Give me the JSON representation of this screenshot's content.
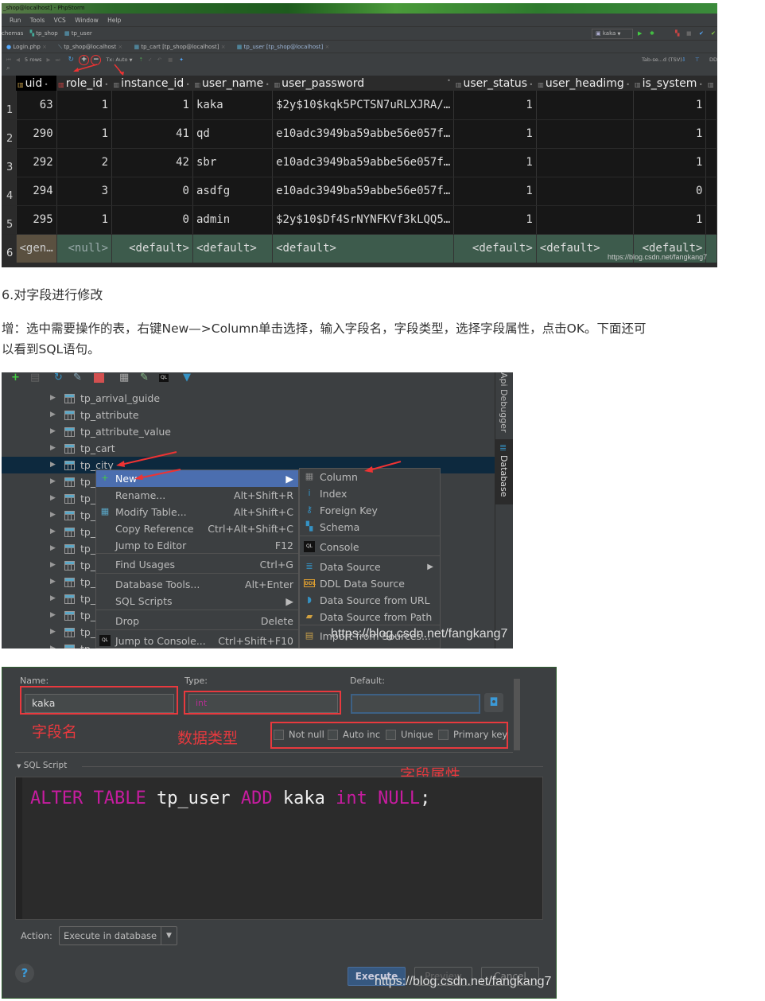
{
  "ide": {
    "window_title": "_shop@localhost] - PhpStorm",
    "menu": [
      "Run",
      "Tools",
      "VCS",
      "Window",
      "Help"
    ],
    "nav_path": [
      "chemas",
      "tp_shop",
      "tp_user"
    ],
    "run_config": "kaka",
    "tabs": [
      {
        "label": "Login.php",
        "active": false
      },
      {
        "label": "tp_shop@localhost",
        "active": false
      },
      {
        "label": "tp_cart [tp_shop@localhost]",
        "active": false
      },
      {
        "label": "tp_user [tp_shop@localhost]",
        "active": true
      }
    ],
    "toolbar": {
      "rows_label": "5 rows",
      "add_row": "+",
      "remove_row": "−",
      "tx_mode": "Tx: Auto",
      "export_format": "Tab-se...d (TSV)",
      "ddl": "DD"
    }
  },
  "grid": {
    "columns": [
      "uid",
      "role_id",
      "instance_id",
      "user_name",
      "user_password",
      "user_status",
      "user_headimg",
      "is_system"
    ],
    "rows": [
      {
        "n": "1",
        "cells": [
          "63",
          "1",
          "1",
          "kaka",
          "$2y$10$kqk5PCTSN7uRLXJRA/…",
          "1",
          "",
          "1"
        ]
      },
      {
        "n": "2",
        "cells": [
          "290",
          "1",
          "41",
          "qd",
          "e10adc3949ba59abbe56e057f…",
          "1",
          "",
          "1"
        ]
      },
      {
        "n": "3",
        "cells": [
          "292",
          "2",
          "42",
          "sbr",
          "e10adc3949ba59abbe56e057f…",
          "1",
          "",
          "1"
        ]
      },
      {
        "n": "4",
        "cells": [
          "294",
          "3",
          "0",
          "asdfg",
          "e10adc3949ba59abbe56e057f…",
          "1",
          "",
          "0"
        ]
      },
      {
        "n": "5",
        "cells": [
          "295",
          "1",
          "0",
          "admin",
          "$2y$10$Df4SrNYNFKVf3kLQQ5…",
          "1",
          "",
          "1"
        ]
      }
    ],
    "new_row": {
      "n": "6",
      "cells": [
        "<gen…",
        "<null>",
        "<default>",
        "<default>",
        "<default>",
        "<default>",
        "<default>",
        "<default>"
      ]
    },
    "watermark": "https://blog.csdn.net/fangkang7"
  },
  "article": {
    "heading": "6.对字段进行修改",
    "para_line1": "增：选中需要操作的表，右键New—>Column单击选择，输入字段名，字段类型，选择字段属性，点击OK。下面还可",
    "para_line2": "以看到SQL语句。"
  },
  "db_panel": {
    "tree": [
      "tp_arrival_guide",
      "tp_attribute",
      "tp_attribute_value",
      "tp_cart",
      "tp_city",
      "tp_",
      "tp_",
      "tp_",
      "tp_",
      "tp_",
      "tp_",
      "tp_",
      "tp_",
      "tp_",
      "tp_",
      "tp_"
    ],
    "selected_index": 4,
    "context_menu": [
      {
        "label": "New",
        "shortcut": "",
        "submenu": true,
        "icon": "plus-icon"
      },
      {
        "label": "Rename...",
        "shortcut": "Alt+Shift+R"
      },
      {
        "label": "Modify Table...",
        "shortcut": "Alt+Shift+C",
        "icon": "table-icon"
      },
      {
        "label": "Copy Reference",
        "shortcut": "Ctrl+Alt+Shift+C"
      },
      {
        "label": "Jump to Editor",
        "shortcut": "F12"
      },
      {
        "label": "Find Usages",
        "shortcut": "Ctrl+G"
      },
      {
        "label": "Database Tools...",
        "shortcut": "Alt+Enter"
      },
      {
        "label": "SQL Scripts",
        "shortcut": "",
        "submenu": true
      },
      {
        "label": "Drop",
        "shortcut": "Delete"
      },
      {
        "label": "Jump to Console...",
        "shortcut": "Ctrl+Shift+F10",
        "icon": "console-icon"
      }
    ],
    "submenu": [
      {
        "label": "Column",
        "icon": "column-icon"
      },
      {
        "label": "Index",
        "icon": "index-icon"
      },
      {
        "label": "Foreign Key",
        "icon": "key-icon"
      },
      {
        "label": "Schema",
        "icon": "schema-icon"
      },
      {
        "label": "Console",
        "icon": "console-icon"
      },
      {
        "label": "Data Source",
        "icon": "datasource-icon",
        "submenu": true
      },
      {
        "label": "DDL Data Source",
        "icon": "ddl-icon"
      },
      {
        "label": "Data Source from URL",
        "icon": "plug-icon"
      },
      {
        "label": "Data Source from Path",
        "icon": "folder-icon"
      },
      {
        "label": "Import from Sources...",
        "icon": "import-icon"
      }
    ],
    "side_tabs": [
      "Api Debugger",
      "Database"
    ],
    "watermark": "https://blog.csdn.net/fangkang7"
  },
  "column_dialog": {
    "name_label": "Name:",
    "name_value": "kaka",
    "type_label": "Type:",
    "type_value": "int",
    "default_label": "Default:",
    "default_value": "",
    "checkboxes": [
      {
        "label": "Not null",
        "checked": false
      },
      {
        "label": "Auto inc",
        "checked": false
      },
      {
        "label": "Unique",
        "checked": false
      },
      {
        "label": "Primary key",
        "checked": false
      }
    ],
    "annotations": {
      "name": "字段名",
      "type": "数据类型",
      "attrs": "字段属性"
    },
    "sql_section_label": "SQL Script",
    "sql": {
      "kw1": "ALTER TABLE",
      "table": " tp_user ",
      "kw2": "ADD",
      "col": " kaka ",
      "type": "int",
      "nullkw": " NULL",
      "end": ";"
    },
    "action_label": "Action:",
    "action_value": "Execute in database",
    "buttons": {
      "execute": "Execute",
      "preview": "Preview",
      "cancel": "Cancel"
    },
    "help": "?",
    "watermark": "https://blog.csdn.net/fangkang7"
  }
}
